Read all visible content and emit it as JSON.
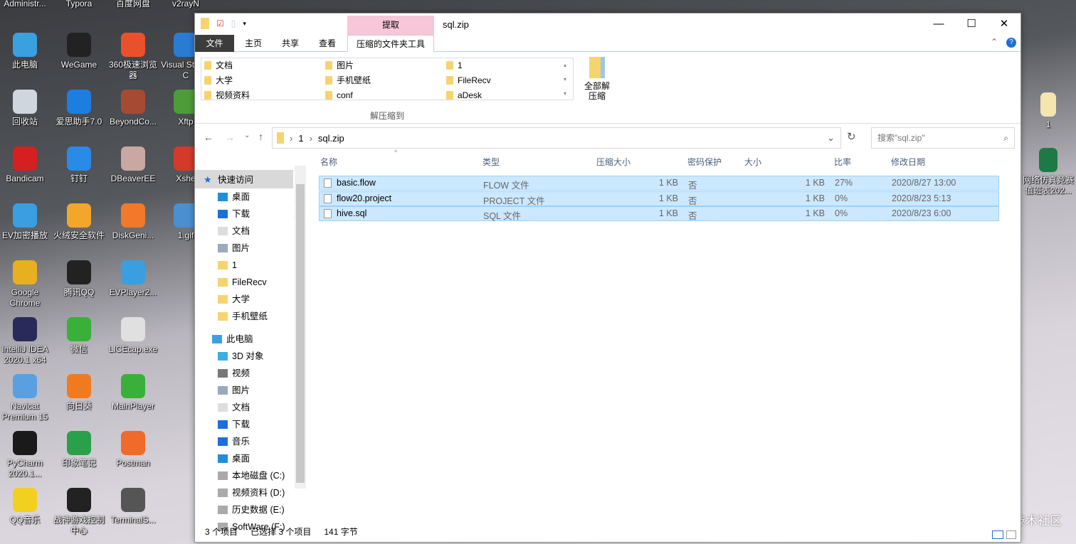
{
  "desktop": {
    "icons": [
      {
        "label": "Administr...",
        "color": "#444"
      },
      {
        "label": "Typora",
        "color": "#444"
      },
      {
        "label": "百度网盘",
        "color": "#444"
      },
      {
        "label": "v2rayN",
        "color": "#444"
      },
      {
        "label": "此电脑",
        "color": "#3aa0e0"
      },
      {
        "label": "WeGame",
        "color": "#222"
      },
      {
        "label": "360极速浏览器",
        "color": "#e9512c"
      },
      {
        "label": "Visual Studio C",
        "color": "#2a7cd3"
      },
      {
        "label": "回收站",
        "color": "#cfd6de"
      },
      {
        "label": "爱思助手7.0",
        "color": "#1b7ee0"
      },
      {
        "label": "BeyondCo...",
        "color": "#a74a34"
      },
      {
        "label": "Xftp",
        "color": "#4c9c3a"
      },
      {
        "label": "Bandicam",
        "color": "#d42020"
      },
      {
        "label": "钉钉",
        "color": "#2a8ae8"
      },
      {
        "label": "DBeaverEE",
        "color": "#c8a8a0"
      },
      {
        "label": "Xshe",
        "color": "#d43a2a"
      },
      {
        "label": "EV加密播放",
        "color": "#3a9ee0"
      },
      {
        "label": "火绒安全软件",
        "color": "#f2a62a"
      },
      {
        "label": "DiskGeni...",
        "color": "#f07a2a"
      },
      {
        "label": "1.gif",
        "color": "#4a8fd0"
      },
      {
        "label": "Google Chrome",
        "color": "#e8b020"
      },
      {
        "label": "腾讯QQ",
        "color": "#222"
      },
      {
        "label": "EVPlayer2...",
        "color": "#3a9ee0"
      },
      {
        "label": "IntelliJ IDEA 2020.1 x64",
        "color": "#2a2a5a"
      },
      {
        "label": "微信",
        "color": "#3ab03a"
      },
      {
        "label": "LICEcap.exe",
        "color": "#e0e0e0"
      },
      {
        "label": "Navicat Premium 15",
        "color": "#5aa0e0"
      },
      {
        "label": "向日葵",
        "color": "#f07a20"
      },
      {
        "label": "MainPlayer",
        "color": "#3ab03a"
      },
      {
        "label": "PyCharm 2020.1...",
        "color": "#1a1a1a"
      },
      {
        "label": "印象笔记",
        "color": "#2aa04a"
      },
      {
        "label": "Postman",
        "color": "#f06a2a"
      },
      {
        "label": "QQ音乐",
        "color": "#f2d020"
      },
      {
        "label": "战神游戏控制中心",
        "color": "#222"
      },
      {
        "label": "TerminalS...",
        "color": "#555"
      }
    ],
    "right_icons": [
      {
        "label": "1"
      },
      {
        "label": "网络仿真竞赛值班表202..."
      }
    ],
    "watermark": "@稀土掘金技术社区"
  },
  "window": {
    "title": "sql.zip",
    "context_tab": "提取",
    "tabs": [
      "文件",
      "主页",
      "共享",
      "查看",
      "压缩的文件夹工具"
    ],
    "gallery": [
      "文档",
      "图片",
      "1",
      "大学",
      "手机壁纸",
      "FileRecv",
      "视频资料",
      "conf",
      "aDesk"
    ],
    "extract_all": "全部解压缩",
    "group_label": "解压缩到",
    "breadcrumb": [
      "1",
      "sql.zip"
    ],
    "search_placeholder": "搜索\"sql.zip\"",
    "columns": [
      "名称",
      "类型",
      "压缩大小",
      "密码保护",
      "大小",
      "比率",
      "修改日期"
    ],
    "files": [
      {
        "name": "basic.flow",
        "type": "FLOW 文件",
        "csize": "1 KB",
        "pw": "否",
        "size": "1 KB",
        "ratio": "27%",
        "date": "2020/8/27 13:00"
      },
      {
        "name": "flow20.project",
        "type": "PROJECT 文件",
        "csize": "1 KB",
        "pw": "否",
        "size": "1 KB",
        "ratio": "0%",
        "date": "2020/8/23 5:13"
      },
      {
        "name": "hive.sql",
        "type": "SQL 文件",
        "csize": "1 KB",
        "pw": "否",
        "size": "1 KB",
        "ratio": "0%",
        "date": "2020/8/23 6:00"
      }
    ],
    "nav": {
      "quick_access": "快速访问",
      "quick": [
        "桌面",
        "下载",
        "文档",
        "图片",
        "1",
        "FileRecv",
        "大学",
        "手机壁纸"
      ],
      "this_pc": "此电脑",
      "pc": [
        "3D 对象",
        "视频",
        "图片",
        "文档",
        "下载",
        "音乐",
        "桌面",
        "本地磁盘 (C:)",
        "视频资料 (D:)",
        "历史数据 (E:)",
        "SoftWare (F:)"
      ]
    },
    "status": {
      "count": "3 个项目",
      "selected": "已选择 3 个项目",
      "bytes": "141 字节"
    }
  }
}
